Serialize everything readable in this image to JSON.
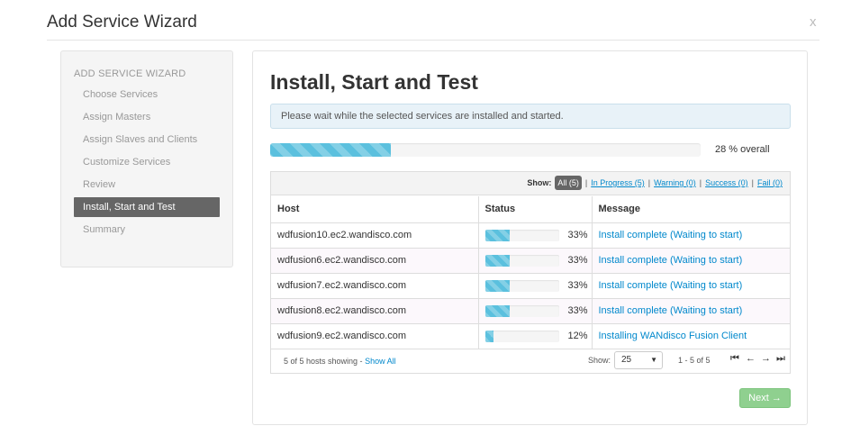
{
  "modal": {
    "title": "Add Service Wizard",
    "close_label": "x"
  },
  "sidebar": {
    "header": "ADD SERVICE WIZARD",
    "items": [
      {
        "label": "Choose Services"
      },
      {
        "label": "Assign Masters"
      },
      {
        "label": "Assign Slaves and Clients"
      },
      {
        "label": "Customize Services"
      },
      {
        "label": "Review"
      },
      {
        "label": "Install, Start and Test"
      },
      {
        "label": "Summary"
      }
    ],
    "active_index": 5
  },
  "main": {
    "title": "Install, Start and Test",
    "info": "Please wait while the selected services are installed and started.",
    "overall_progress": 28,
    "overall_label": "28 % overall"
  },
  "filters": {
    "show_label": "Show:",
    "all": "All (5)",
    "in_progress": "In Progress (5)",
    "warning": "Warning (0)",
    "success": "Success (0)",
    "fail": "Fail (0)",
    "separator": "|"
  },
  "table": {
    "headers": {
      "host": "Host",
      "status": "Status",
      "message": "Message"
    },
    "rows": [
      {
        "host": "wdfusion10.ec2.wandisco.com",
        "progress": 33,
        "percent": "33%",
        "message": "Install complete (Waiting to start)"
      },
      {
        "host": "wdfusion6.ec2.wandisco.com",
        "progress": 33,
        "percent": "33%",
        "message": "Install complete (Waiting to start)"
      },
      {
        "host": "wdfusion7.ec2.wandisco.com",
        "progress": 33,
        "percent": "33%",
        "message": "Install complete (Waiting to start)"
      },
      {
        "host": "wdfusion8.ec2.wandisco.com",
        "progress": 33,
        "percent": "33%",
        "message": "Install complete (Waiting to start)"
      },
      {
        "host": "wdfusion9.ec2.wandisco.com",
        "progress": 12,
        "percent": "12%",
        "message": "Installing WANdisco Fusion Client"
      }
    ]
  },
  "footer": {
    "hosts_showing": "5 of 5 hosts showing - ",
    "show_all": "Show All",
    "show_label": "Show:",
    "page_size": "25",
    "range": "1 - 5 of 5"
  },
  "buttons": {
    "next": "Next →"
  },
  "colors": {
    "progress": "#5bc0de",
    "next_button": "#8fd08f",
    "link": "#0088cc",
    "active_nav": "#666666"
  }
}
